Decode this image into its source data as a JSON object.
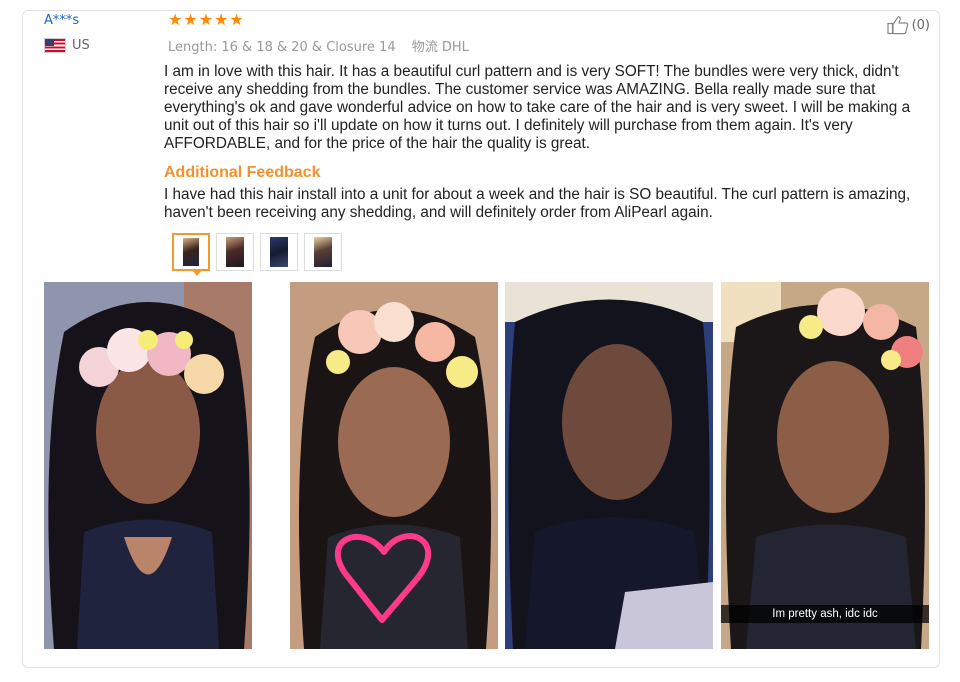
{
  "user": {
    "name": "A***s",
    "country": "US"
  },
  "rating": {
    "stars": 5,
    "max": 5,
    "color": "#ff8a00"
  },
  "meta": {
    "length_label": "Length:",
    "length_value": "16 & 18 & 20 & Closure 14",
    "shipping_label": "物流",
    "shipping_value": "DHL"
  },
  "helpful": {
    "count": "(0)",
    "icon": "thumbs-up-icon"
  },
  "review": {
    "text": "I am in love with this hair. It has a beautiful curl pattern and is very SOFT! The bundles were very thick, didn't receive any shedding from the bundles. The customer service was AMAZING. Bella really made sure that everything's ok and gave wonderful advice on how to take care of the hair and is very sweet. I will be making a unit out of this hair so i'll update on how it turns out. I definitely will purchase from them again. It's very AFFORDABLE, and for the price of the hair the quality is great."
  },
  "additional_feedback": {
    "title": "Additional Feedback",
    "text": "I have had this hair install into a unit for about a week and the hair is SO beautiful. The curl pattern is amazing, haven't been receiving any shedding, and will definitely order from AliPearl again."
  },
  "thumbnails": {
    "count": 4,
    "active_index": 0,
    "active_color": "#f39a2c"
  },
  "photos": [
    {
      "id": "photo-1"
    },
    {
      "id": "photo-2"
    },
    {
      "id": "photo-3"
    },
    {
      "id": "photo-4",
      "caption": "Im pretty ash, idc idc"
    }
  ],
  "colors": {
    "accent": "#f39a2c",
    "user_link": "#1a66c9",
    "feedback_title": "#f0922f"
  }
}
